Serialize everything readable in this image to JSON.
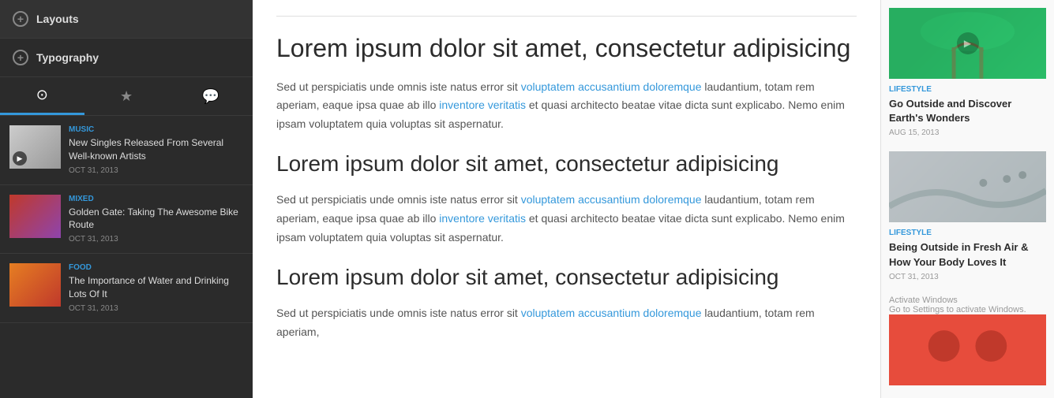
{
  "sidebar": {
    "menu": [
      {
        "label": "Layouts",
        "icon": "+"
      },
      {
        "label": "Typography",
        "icon": "+"
      }
    ],
    "tabs": [
      {
        "label": "⊙",
        "active": true
      },
      {
        "label": "★",
        "active": false
      },
      {
        "label": "💬",
        "active": false
      }
    ],
    "articles": [
      {
        "category": "MUSIC",
        "title": "New Singles Released From Several Well-known Artists",
        "date": "OCT 31, 2013",
        "thumb_type": "music",
        "has_play": true
      },
      {
        "category": "MIXED",
        "title": "Golden Gate: Taking The Awesome Bike Route",
        "date": "OCT 31, 2013",
        "thumb_type": "mixed",
        "has_play": false
      },
      {
        "category": "FOOD",
        "title": "The Importance of Water and Drinking Lots Of It",
        "date": "OCT 31, 2013",
        "thumb_type": "food",
        "has_play": false
      }
    ]
  },
  "main": {
    "sections": [
      {
        "title": "Lorem ipsum dolor sit amet, consectetur adipisicing",
        "size": "large",
        "body": "Sed ut perspiciatis unde omnis iste natus error sit voluptatem accusantium doloremque laudantium, totam rem aperiam, eaque ipsa quae ab illo inventore veritatis et quasi architecto beatae vitae dicta sunt explicabo. Nemo enim ipsam voluptatem quia voluptas sit aspernatur."
      },
      {
        "title": "Lorem ipsum dolor sit amet, consectetur adipisicing",
        "size": "medium",
        "body": "Sed ut perspiciatis unde omnis iste natus error sit voluptatem accusantium doloremque laudantium, totam rem aperiam, eaque ipsa quae ab illo inventore veritatis et quasi architecto beatae vitae dicta sunt explicabo. Nemo enim ipsam voluptatem quia voluptas sit aspernatur."
      },
      {
        "title": "Lorem ipsum dolor sit amet, consectetur adipisicing",
        "size": "medium",
        "body": "Sed ut perspiciatis unde omnis iste natus error sit voluptatem accusantium doloremque laudantium, totam rem aperiam,"
      }
    ]
  },
  "right_sidebar": {
    "articles": [
      {
        "category": "LIFESTYLE",
        "title": "Go Outside and Discover Earth's Wonders",
        "date": "AUG 15, 2013",
        "img_type": "nature",
        "has_play": true
      },
      {
        "category": "LIFESTYLE",
        "title": "Being Outside in Fresh Air & How Your Body Loves It",
        "date": "OCT 31, 2013",
        "img_type": "skate",
        "has_play": false
      },
      {
        "category": "",
        "title": "",
        "date": "",
        "img_type": "people",
        "has_play": false
      }
    ],
    "activate_text": "Activate Windows",
    "activate_subtext": "Go to Settings to activate Windows."
  }
}
